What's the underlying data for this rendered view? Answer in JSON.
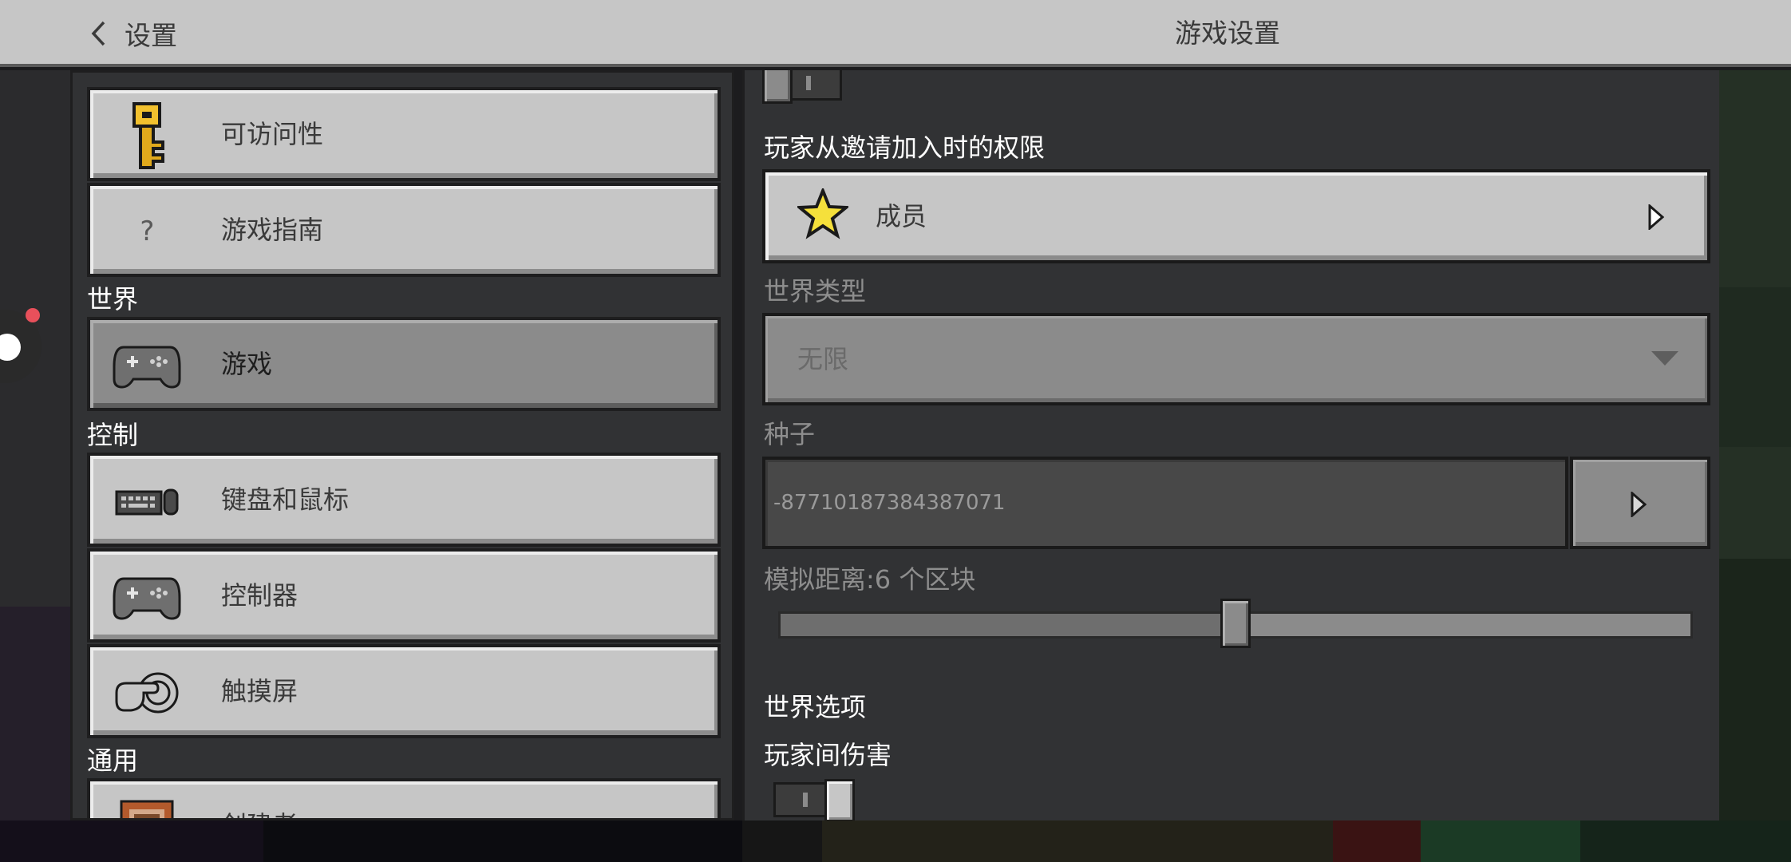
{
  "topbar": {
    "back_label": "设置",
    "title": "游戏设置"
  },
  "nav": {
    "items_top": [
      {
        "label": "可访问性",
        "icon": "key-icon"
      },
      {
        "label": "游戏指南",
        "icon": "question-icon"
      }
    ],
    "sections": {
      "world": "世界",
      "controls": "控制",
      "general": "通用"
    },
    "world_items": [
      {
        "label": "游戏",
        "icon": "gamepad-icon",
        "selected": true
      }
    ],
    "control_items": [
      {
        "label": "键盘和鼠标",
        "icon": "keyboard-mouse-icon"
      },
      {
        "label": "控制器",
        "icon": "controller-icon"
      },
      {
        "label": "触摸屏",
        "icon": "touch-hand-icon"
      }
    ],
    "general_items": [
      {
        "label": "创建者",
        "icon": "creator-icon"
      }
    ]
  },
  "game_settings": {
    "invite_permission": {
      "label": "玩家从邀请加入时的权限",
      "value": "成员",
      "icon": "star-icon"
    },
    "world_type": {
      "label": "世界类型",
      "value": "无限",
      "icon": "dropdown-arrow-icon"
    },
    "seed": {
      "label": "种子",
      "value": "-87710187384387071"
    },
    "simulation_distance": {
      "label": "模拟距离:6  个区块",
      "value": 6,
      "fraction": 0.5
    },
    "world_options": {
      "heading": "世界选项"
    },
    "pvp": {
      "label": "玩家间伤害",
      "on": true
    }
  },
  "colors": {
    "panel": "#313234",
    "button_light": "#c6c6c6",
    "button_selected": "#8b8b8b",
    "topbar": "#c6c6c6",
    "record_dot": "#e8505b"
  }
}
